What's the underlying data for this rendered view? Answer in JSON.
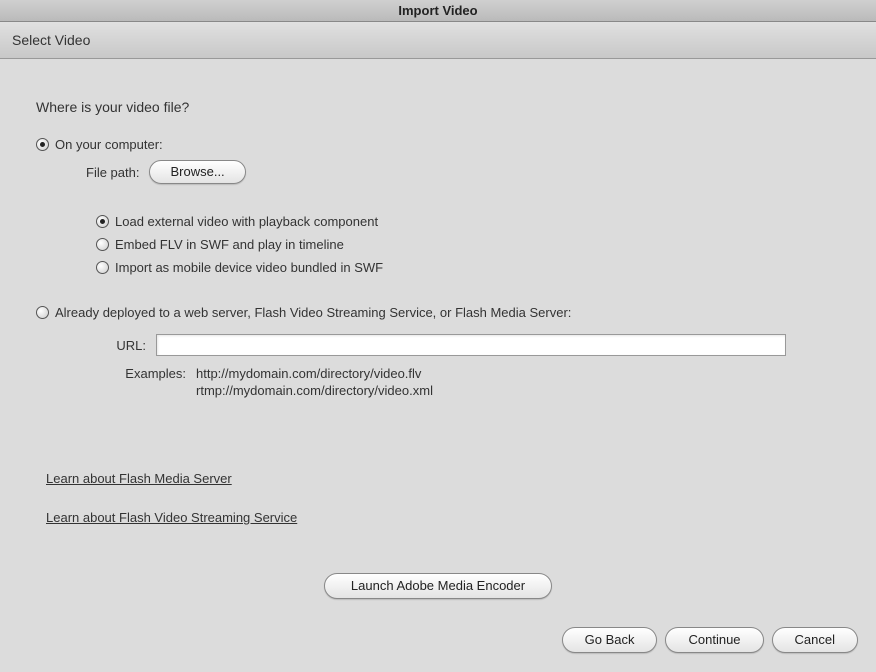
{
  "titlebar": "Import Video",
  "subtitle": "Select Video",
  "heading": "Where is your video file?",
  "location": {
    "on_computer": {
      "label": "On your computer:",
      "selected": true
    },
    "deployed": {
      "label": "Already deployed to a web server, Flash Video Streaming Service, or Flash Media Server:",
      "selected": false
    }
  },
  "file_path": {
    "label": "File path:",
    "browse": "Browse..."
  },
  "options": {
    "load_external": {
      "label": "Load external video with playback component",
      "selected": true
    },
    "embed_flv": {
      "label": "Embed FLV in SWF and play in timeline",
      "selected": false
    },
    "mobile": {
      "label": "Import as mobile device video bundled in SWF",
      "selected": false
    }
  },
  "url": {
    "label": "URL:",
    "value": ""
  },
  "examples": {
    "label": "Examples:",
    "list": [
      "http://mydomain.com/directory/video.flv",
      "rtmp://mydomain.com/directory/video.xml"
    ]
  },
  "links": {
    "fms": "Learn about Flash Media Server",
    "fvss": "Learn about Flash Video Streaming Service"
  },
  "launch": "Launch Adobe Media Encoder",
  "footer": {
    "go_back": "Go Back",
    "continue": "Continue",
    "cancel": "Cancel"
  }
}
